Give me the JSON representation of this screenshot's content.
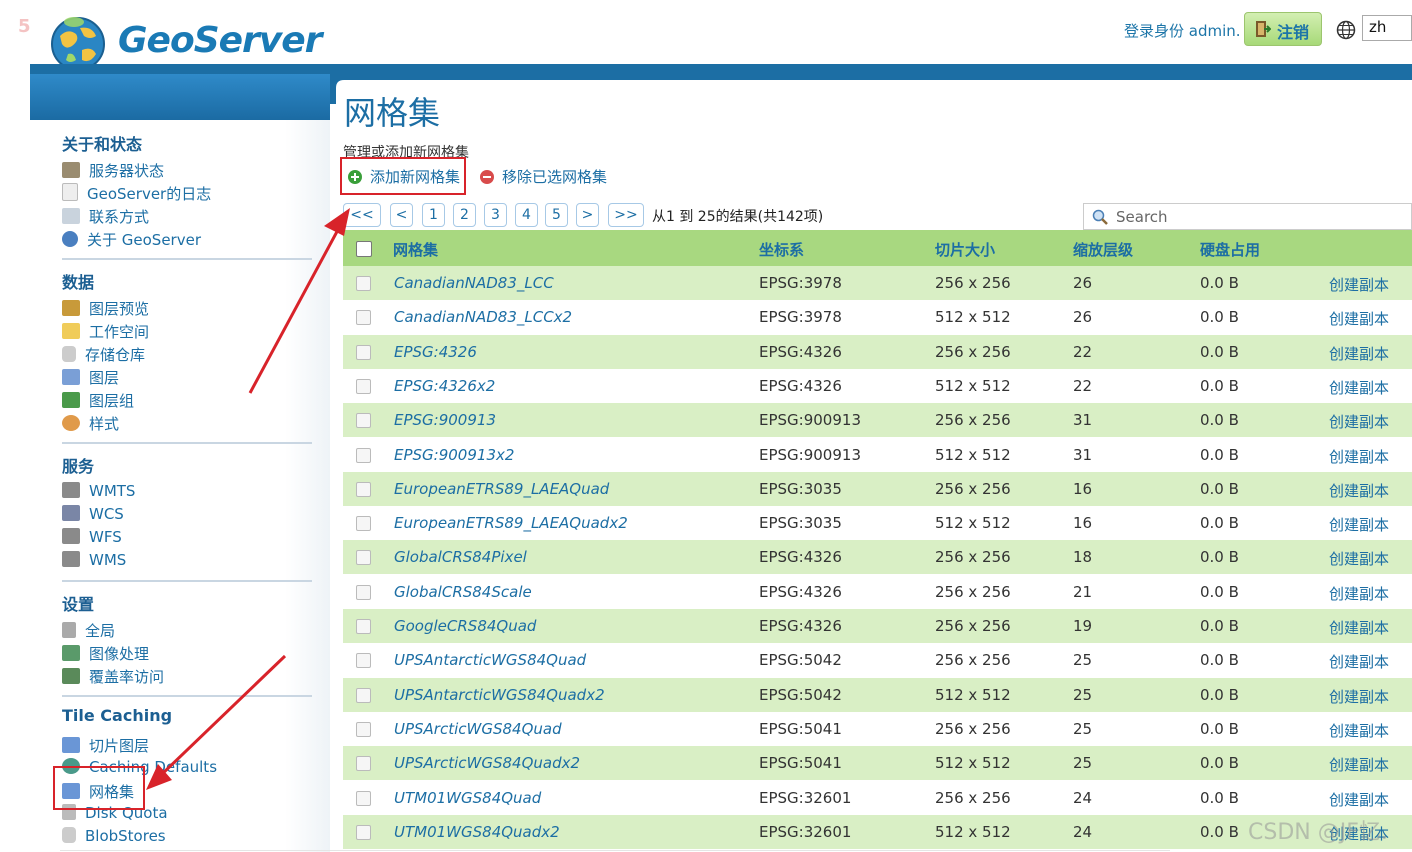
{
  "page_number": "5",
  "header": {
    "logo_text": "GeoServer",
    "login_text": "登录身份 admin.",
    "logout_label": "注销",
    "language": "zh"
  },
  "sidebar": {
    "sections": [
      {
        "title": "关于和状态",
        "items": [
          {
            "label": "服务器状态",
            "icon": "server-status-icon"
          },
          {
            "label": "GeoServer的日志",
            "icon": "log-icon"
          },
          {
            "label": "联系方式",
            "icon": "contact-icon"
          },
          {
            "label": "关于 GeoServer",
            "icon": "about-icon"
          }
        ]
      },
      {
        "title": "数据",
        "items": [
          {
            "label": "图层预览",
            "icon": "layer-preview-icon"
          },
          {
            "label": "工作空间",
            "icon": "workspace-icon"
          },
          {
            "label": "存储仓库",
            "icon": "store-icon"
          },
          {
            "label": "图层",
            "icon": "layer-icon"
          },
          {
            "label": "图层组",
            "icon": "layer-group-icon"
          },
          {
            "label": "样式",
            "icon": "style-icon"
          }
        ]
      },
      {
        "title": "服务",
        "items": [
          {
            "label": "WMTS",
            "icon": "service-icon"
          },
          {
            "label": "WCS",
            "icon": "service-icon"
          },
          {
            "label": "WFS",
            "icon": "service-icon"
          },
          {
            "label": "WMS",
            "icon": "service-icon"
          }
        ]
      },
      {
        "title": "设置",
        "items": [
          {
            "label": "全局",
            "icon": "global-icon"
          },
          {
            "label": "图像处理",
            "icon": "image-processing-icon"
          },
          {
            "label": "覆盖率访问",
            "icon": "coverage-icon"
          }
        ]
      },
      {
        "title": "Tile Caching",
        "items": [
          {
            "label": "切片图层",
            "icon": "tile-layer-icon"
          },
          {
            "label": "Caching Defaults",
            "icon": "caching-defaults-icon"
          },
          {
            "label": "网格集",
            "icon": "gridset-icon"
          },
          {
            "label": "Disk Quota",
            "icon": "disk-quota-icon"
          },
          {
            "label": "BlobStores",
            "icon": "blobstore-icon"
          }
        ]
      }
    ]
  },
  "main": {
    "title": "网格集",
    "subtitle": "管理或添加新网格集",
    "add_label": "添加新网格集",
    "remove_label": "移除已选网格集",
    "pager": {
      "buttons": [
        "<<",
        "<",
        "1",
        "2",
        "3",
        "4",
        "5",
        ">",
        ">>"
      ],
      "result_text": "从1 到 25的结果(共142项)"
    },
    "search_placeholder": "Search",
    "columns": [
      "网格集",
      "坐标系",
      "切片大小",
      "缩放层级",
      "硬盘占用"
    ],
    "rows": [
      {
        "name": "CanadianNAD83_LCC",
        "crs": "EPSG:3978",
        "tile": "256 x 256",
        "zoom": "26",
        "disk": "0.0 B",
        "action": "创建副本"
      },
      {
        "name": "CanadianNAD83_LCCx2",
        "crs": "EPSG:3978",
        "tile": "512 x 512",
        "zoom": "26",
        "disk": "0.0 B",
        "action": "创建副本"
      },
      {
        "name": "EPSG:4326",
        "crs": "EPSG:4326",
        "tile": "256 x 256",
        "zoom": "22",
        "disk": "0.0 B",
        "action": "创建副本"
      },
      {
        "name": "EPSG:4326x2",
        "crs": "EPSG:4326",
        "tile": "512 x 512",
        "zoom": "22",
        "disk": "0.0 B",
        "action": "创建副本"
      },
      {
        "name": "EPSG:900913",
        "crs": "EPSG:900913",
        "tile": "256 x 256",
        "zoom": "31",
        "disk": "0.0 B",
        "action": "创建副本"
      },
      {
        "name": "EPSG:900913x2",
        "crs": "EPSG:900913",
        "tile": "512 x 512",
        "zoom": "31",
        "disk": "0.0 B",
        "action": "创建副本"
      },
      {
        "name": "EuropeanETRS89_LAEAQuad",
        "crs": "EPSG:3035",
        "tile": "256 x 256",
        "zoom": "16",
        "disk": "0.0 B",
        "action": "创建副本"
      },
      {
        "name": "EuropeanETRS89_LAEAQuadx2",
        "crs": "EPSG:3035",
        "tile": "512 x 512",
        "zoom": "16",
        "disk": "0.0 B",
        "action": "创建副本"
      },
      {
        "name": "GlobalCRS84Pixel",
        "crs": "EPSG:4326",
        "tile": "256 x 256",
        "zoom": "18",
        "disk": "0.0 B",
        "action": "创建副本"
      },
      {
        "name": "GlobalCRS84Scale",
        "crs": "EPSG:4326",
        "tile": "256 x 256",
        "zoom": "21",
        "disk": "0.0 B",
        "action": "创建副本"
      },
      {
        "name": "GoogleCRS84Quad",
        "crs": "EPSG:4326",
        "tile": "256 x 256",
        "zoom": "19",
        "disk": "0.0 B",
        "action": "创建副本"
      },
      {
        "name": "UPSAntarcticWGS84Quad",
        "crs": "EPSG:5042",
        "tile": "256 x 256",
        "zoom": "25",
        "disk": "0.0 B",
        "action": "创建副本"
      },
      {
        "name": "UPSAntarcticWGS84Quadx2",
        "crs": "EPSG:5042",
        "tile": "512 x 512",
        "zoom": "25",
        "disk": "0.0 B",
        "action": "创建副本"
      },
      {
        "name": "UPSArcticWGS84Quad",
        "crs": "EPSG:5041",
        "tile": "256 x 256",
        "zoom": "25",
        "disk": "0.0 B",
        "action": "创建副本"
      },
      {
        "name": "UPSArcticWGS84Quadx2",
        "crs": "EPSG:5041",
        "tile": "512 x 512",
        "zoom": "25",
        "disk": "0.0 B",
        "action": "创建副本"
      },
      {
        "name": "UTM01WGS84Quad",
        "crs": "EPSG:32601",
        "tile": "256 x 256",
        "zoom": "24",
        "disk": "0.0 B",
        "action": "创建副本"
      },
      {
        "name": "UTM01WGS84Quadx2",
        "crs": "EPSG:32601",
        "tile": "512 x 512",
        "zoom": "24",
        "disk": "0.0 B",
        "action": "创建副本"
      }
    ]
  },
  "watermark": "CSDN @JF忆.",
  "colors": {
    "accent": "#1c6ea4",
    "row_highlight": "#d9efc5",
    "header_green": "#a8d880",
    "annotation_red": "#d8232a"
  }
}
